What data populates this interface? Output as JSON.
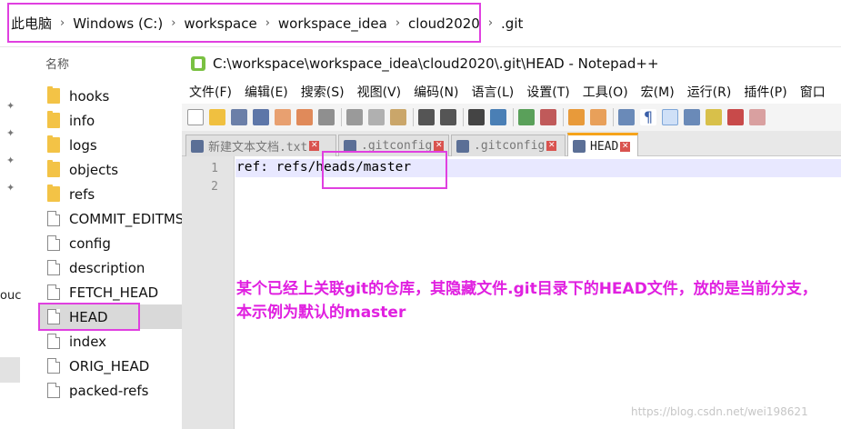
{
  "breadcrumb": {
    "items": [
      "此电脑",
      "Windows (C:)",
      "workspace",
      "workspace_idea",
      "cloud2020",
      ".git"
    ],
    "separator": "›"
  },
  "explorer": {
    "column_header": "名称",
    "items": [
      {
        "label": "hooks",
        "type": "folder"
      },
      {
        "label": "info",
        "type": "folder"
      },
      {
        "label": "logs",
        "type": "folder"
      },
      {
        "label": "objects",
        "type": "folder"
      },
      {
        "label": "refs",
        "type": "folder"
      },
      {
        "label": "COMMIT_EDITMSG",
        "type": "file"
      },
      {
        "label": "config",
        "type": "file"
      },
      {
        "label": "description",
        "type": "file"
      },
      {
        "label": "FETCH_HEAD",
        "type": "file"
      },
      {
        "label": "HEAD",
        "type": "file",
        "selected": true
      },
      {
        "label": "index",
        "type": "file"
      },
      {
        "label": "ORIG_HEAD",
        "type": "file"
      },
      {
        "label": "packed-refs",
        "type": "file"
      }
    ],
    "side_text": "ouc"
  },
  "notepad": {
    "title": "C:\\workspace\\workspace_idea\\cloud2020\\.git\\HEAD - Notepad++",
    "menus": [
      "文件(F)",
      "编辑(E)",
      "搜索(S)",
      "视图(V)",
      "编码(N)",
      "语言(L)",
      "设置(T)",
      "工具(O)",
      "宏(M)",
      "运行(R)",
      "插件(P)",
      "窗口"
    ],
    "tabs": [
      {
        "label": "新建文本文档.txt",
        "active": false
      },
      {
        "label": ".gitconfig",
        "active": false
      },
      {
        "label": ".gitconfig",
        "active": false
      },
      {
        "label": "HEAD",
        "active": true
      }
    ],
    "line_numbers": [
      "1",
      "2"
    ],
    "code_line_1": "ref: refs/heads/master",
    "code_line_2": ""
  },
  "annotation": {
    "text": "某个已经上关联git的仓库，其隐藏文件.git目录下的HEAD文件，放的是当前分支， 本示例为默认的master"
  },
  "watermark": "https://blog.csdn.net/wei198621",
  "colors": {
    "highlight": "#e040e0",
    "annotation": "#e020e0",
    "active_tab_accent": "#f6a31a"
  }
}
